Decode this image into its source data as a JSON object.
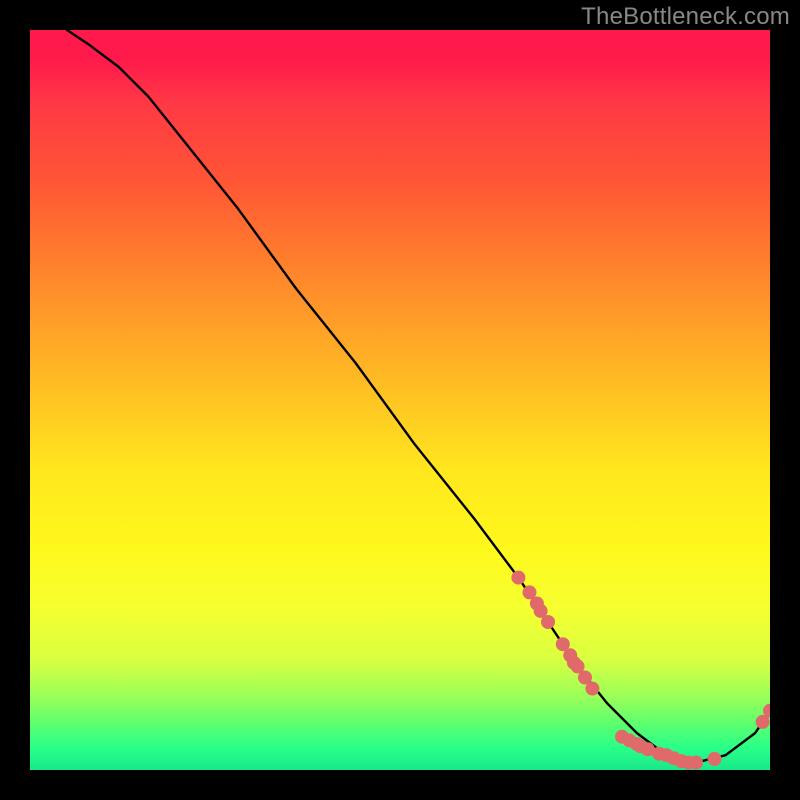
{
  "watermark": "TheBottleneck.com",
  "chart_data": {
    "type": "line",
    "title": "",
    "xlabel": "",
    "ylabel": "",
    "xlim": [
      0,
      100
    ],
    "ylim": [
      0,
      100
    ],
    "series": [
      {
        "name": "curve",
        "x": [
          5,
          8,
          12,
          16,
          20,
          28,
          36,
          44,
          52,
          60,
          66,
          70,
          74,
          78,
          82,
          86,
          90,
          94,
          98,
          100
        ],
        "y": [
          100,
          98,
          95,
          91,
          86,
          76,
          65,
          55,
          44,
          34,
          26,
          20,
          14,
          9,
          5,
          2,
          1,
          2,
          5,
          8
        ]
      }
    ],
    "markers": [
      {
        "x": 66,
        "y": 26
      },
      {
        "x": 67.5,
        "y": 24
      },
      {
        "x": 68.5,
        "y": 22.5
      },
      {
        "x": 69,
        "y": 21.5
      },
      {
        "x": 70,
        "y": 20
      },
      {
        "x": 72,
        "y": 17
      },
      {
        "x": 73,
        "y": 15.5
      },
      {
        "x": 73.5,
        "y": 14.5
      },
      {
        "x": 74,
        "y": 14
      },
      {
        "x": 75,
        "y": 12.5
      },
      {
        "x": 76,
        "y": 11
      },
      {
        "x": 80,
        "y": 4.5
      },
      {
        "x": 81,
        "y": 4
      },
      {
        "x": 82,
        "y": 3.5
      },
      {
        "x": 82.5,
        "y": 3.2
      },
      {
        "x": 83.5,
        "y": 2.8
      },
      {
        "x": 85,
        "y": 2.2
      },
      {
        "x": 86,
        "y": 2
      },
      {
        "x": 87,
        "y": 1.6
      },
      {
        "x": 88,
        "y": 1.2
      },
      {
        "x": 89,
        "y": 1
      },
      {
        "x": 90,
        "y": 1
      },
      {
        "x": 92.5,
        "y": 1.5
      },
      {
        "x": 99,
        "y": 6.5
      },
      {
        "x": 100,
        "y": 8
      }
    ],
    "gradient_stops": [
      {
        "pos": 0,
        "color": "#ff1a4b"
      },
      {
        "pos": 50,
        "color": "#ffc522"
      },
      {
        "pos": 100,
        "color": "#18e88a"
      }
    ]
  }
}
